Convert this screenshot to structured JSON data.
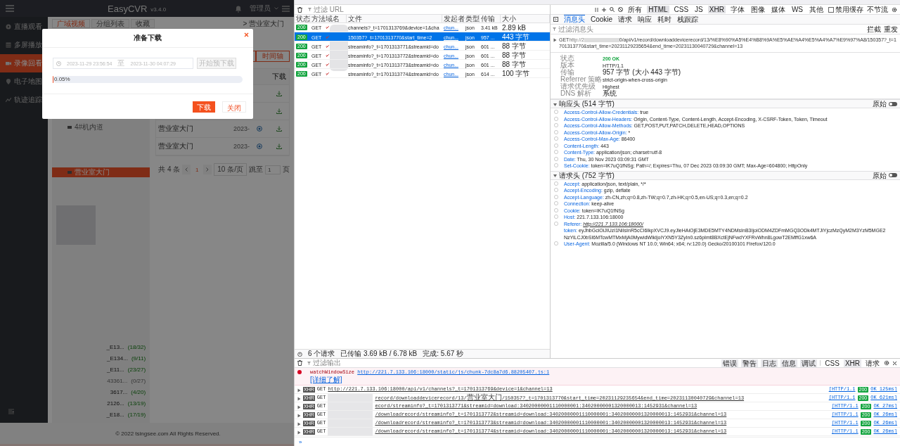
{
  "app": {
    "brand": "EasyCVR",
    "version": "v3.4.0",
    "user": "管理员",
    "nav": [
      {
        "label": "直播观看",
        "selected": false
      },
      {
        "label": "多屏播放",
        "selected": false
      },
      {
        "label": "录像回看",
        "selected": true
      },
      {
        "label": "电子地图",
        "selected": false
      },
      {
        "label": "轨迹追踪",
        "selected": false
      }
    ],
    "tabs": [
      {
        "label": "广域视频",
        "selected": true
      },
      {
        "label": "分组列表",
        "selected": false
      },
      {
        "label": "收藏",
        "selected": false
      }
    ],
    "breadcrumb": "> 营业室大门",
    "tree": {
      "items": [
        {
          "label": "4#机内道",
          "selected": false
        },
        {
          "label": "营业室大门",
          "selected": true
        }
      ],
      "devices": [
        {
          "label": "_E13...",
          "count": "(18/32)",
          "online": true
        },
        {
          "label": "_E134...",
          "count": "(9/11)",
          "online": true
        },
        {
          "label": "_E11...",
          "count": "(23/27)",
          "online": true
        },
        {
          "label": "43361...",
          "count": "(0/27)",
          "online": false
        },
        {
          "label": "3617...",
          "count": "(4/20)",
          "online": true
        },
        {
          "label": "2126...",
          "count": "(13/19)",
          "online": true
        },
        {
          "label": "_E18...",
          "count": "(17/19)",
          "online": true
        }
      ]
    },
    "timeline_button": "时间轴",
    "table": {
      "column": "下载",
      "rows": [
        {},
        {},
        {
          "name": "营业室大门",
          "date": "2023-"
        },
        {
          "name": "营业室大门",
          "date": "2023-"
        }
      ]
    },
    "pagination": {
      "total": "共 4 条",
      "page": "1",
      "page_size": "10 条/页",
      "jump_label": "跳至",
      "jump_value": "1",
      "suffix": "页"
    },
    "footer": "© 2022 tsingsee.com All Rights Reserved.",
    "dialog": {
      "title": "准备下载",
      "start": "2023-11-29 23:56:54",
      "separator": "至",
      "end": "2023-11-30 04:07:29",
      "predownload_button": "开始预下载",
      "predownload_disabled": true,
      "level": 0.0005,
      "progress_text": "0.05%",
      "download_button": "下载",
      "close_button": "关闭"
    }
  },
  "devtools": {
    "url_filter_placeholder": "过滤 URL",
    "type_filters": [
      {
        "label": "所有",
        "selected": false
      },
      {
        "label": "HTML",
        "selected": true
      },
      {
        "label": "CSS",
        "selected": false
      },
      {
        "label": "JS",
        "selected": false
      },
      {
        "label": "XHR",
        "selected": true
      },
      {
        "label": "字体",
        "selected": false
      },
      {
        "label": "图像",
        "selected": false
      },
      {
        "label": "媒体",
        "selected": false
      },
      {
        "label": "WS",
        "selected": false
      },
      {
        "label": "其他",
        "selected": false
      }
    ],
    "disable_cache": {
      "label": "禁用缓存",
      "checked": false
    },
    "throttle": "不节流",
    "network": {
      "columns": [
        "状态",
        "方法",
        "域名",
        "文件",
        "发起者",
        "类型",
        "传输",
        "大小"
      ],
      "rows": [
        {
          "status": "200",
          "method": "GET",
          "file": "channels?_t=1701313769&device=1&cha",
          "initiator": "chun...",
          "type": "json",
          "transferred": "3.41 kB",
          "size": "2.89 kB",
          "selected": false
        },
        {
          "status": "200",
          "method": "GET",
          "file": "150357?_t=1701313770&start_time=2",
          "initiator": "chun...",
          "type": "json",
          "transferred": "957 ...",
          "size": "443 字节",
          "selected": true
        },
        {
          "status": "200",
          "method": "GET",
          "file": "streaminfo?_t=1701313771&streamid=do",
          "initiator": "chun...",
          "type": "json",
          "transferred": "601 ...",
          "size": "88 字节",
          "selected": false
        },
        {
          "status": "200",
          "method": "GET",
          "file": "streaminfo?_t=1701313772&streamid=do",
          "initiator": "chun...",
          "type": "json",
          "transferred": "601 ...",
          "size": "88 字节",
          "selected": false
        },
        {
          "status": "200",
          "method": "GET",
          "file": "streaminfo?_t=1701313773&streamid=do",
          "initiator": "chun...",
          "type": "json",
          "transferred": "601 ...",
          "size": "88 字节",
          "selected": false
        },
        {
          "status": "200",
          "method": "GET",
          "file": "streaminfo?_t=1701313774&streamid=do",
          "initiator": "chun...",
          "type": "json",
          "transferred": "614 ...",
          "size": "100 字节",
          "selected": false
        }
      ],
      "summary": [
        "6 个请求",
        "已传输 3.69 kB / 6.78 kB",
        "完成: 5.67 秒"
      ]
    },
    "detail_tabs": [
      {
        "label": "消息头",
        "selected": true
      },
      {
        "label": "Cookie",
        "selected": false
      },
      {
        "label": "请求",
        "selected": false
      },
      {
        "label": "响应",
        "selected": false
      },
      {
        "label": "耗时",
        "selected": false
      },
      {
        "label": "栈跟踪",
        "selected": false
      }
    ],
    "header_filter_placeholder": "过滤消息头",
    "header_actions": [
      "拦截",
      "重发"
    ],
    "request_line": {
      "method": "GET",
      "url_start": "http://2",
      "url_rest": "0/api/v1/record/downloaddevicerecord/13/%E8%90%A5%E4%B8%9A%E5%AE%A4%E5%A4%A7%E9%97%A8/150357?_t=1701313770&start_time=20231129235654&end_time=20231130040729&channel=13"
    },
    "summary_rows": [
      {
        "label": "状态",
        "value": "200 OK",
        "kind": "status"
      },
      {
        "label": "版本",
        "value": "HTTP/1.1",
        "kind": "text"
      },
      {
        "label": "传输",
        "value": "957 字节 (大小 443 字节)",
        "kind": "text"
      },
      {
        "label": "Referrer 策略",
        "value": "strict-origin-when-cross-origin",
        "kind": "text"
      },
      {
        "label": "请求优先级",
        "value": "Highest",
        "kind": "text"
      },
      {
        "label": "DNS 解析",
        "value": "系统",
        "kind": "text"
      }
    ],
    "sections": [
      {
        "title": "响应头 (514 字节)",
        "raw_label": "原始",
        "raw": false,
        "expanded": true,
        "items": [
          {
            "name": "Access-Control-Allow-Credentials:",
            "value": "true",
            "kind": "text"
          },
          {
            "name": "Access-Control-Allow-Headers:",
            "value": "Origin, Content-Type, Content-Length, Accept-Encoding, X-CSRF-Token, Token, Timeout",
            "kind": "text"
          },
          {
            "name": "Access-Control-Allow-Methods:",
            "value": "GET,POST,PUT,PATCH,DELETE,HEAD,OPTIONS",
            "kind": "text"
          },
          {
            "name": "Access-Control-Allow-Origin:",
            "value": "*",
            "kind": "text"
          },
          {
            "name": "Access-Control-Max-Age:",
            "value": "86400",
            "kind": "text"
          },
          {
            "name": "Content-Length:",
            "value": "443",
            "kind": "text"
          },
          {
            "name": "Content-Type:",
            "value": "application/json; charset=utf-8",
            "kind": "text"
          },
          {
            "name": "Date:",
            "value": "Thu, 30 Nov 2023 03:09:31 GMT",
            "kind": "text"
          },
          {
            "name": "Set-Cookie:",
            "value": "token=lK7uQ1fNSg; Path=/; Expires=Thu, 07 Dec 2023 03:09:30 GMT; Max-Age=604800; HttpOnly",
            "kind": "text"
          }
        ]
      },
      {
        "title": "请求头 (752 字节)",
        "raw_label": "原始",
        "raw": false,
        "expanded": true,
        "items": [
          {
            "name": "Accept:",
            "value": "application/json, text/plain, */*",
            "kind": "text"
          },
          {
            "name": "Accept-Encoding:",
            "value": "gzip, deflate",
            "kind": "text"
          },
          {
            "name": "Accept-Language:",
            "value": "zh-CN,zh;q=0.8,zh-TW;q=0.7,zh-HK;q=0.5,en-US;q=0.3,en;q=0.2",
            "kind": "text"
          },
          {
            "name": "Connection:",
            "value": "keep-alive",
            "kind": "text"
          },
          {
            "name": "Cookie:",
            "value": "token=lK7uQ1fNSg",
            "kind": "text"
          },
          {
            "name": "Host:",
            "value": "221.7.133.106:18000",
            "kind": "text"
          },
          {
            "name": "Referer:",
            "value": "http://221.7.133.106:18000/",
            "kind": "link"
          },
          {
            "name": "token:",
            "value": "eyJhbGciOiJIUzI1NiIsInR5cCI6IkpXVCJ9.eyJleHAiOjE3MDE5MTY4NDMsInB3IjoiODM4ZDFmMGQ3ODk4MTJiYjczMzQyM2M3YzM5MGE2NzYiLCJ0bSI6MTcwMTMxMjA0MywidWlkIjoiYXN5Y3ZyIn0.sz6pImt8BXctEjNFwdYXFRvWhn8LgowT2EMffG1xw6A",
            "kind": "plain"
          },
          {
            "name": "User-Agent:",
            "value": "Mozilla/5.0 (Windows NT 10.0; Win64; x64; rv:120.0) Gecko/20100101 Firefox/120.0",
            "kind": "text"
          }
        ]
      }
    ],
    "console": {
      "filter_placeholder": "过滤输出",
      "levels": [
        {
          "label": "错误",
          "selected": true
        },
        {
          "label": "警告",
          "selected": true
        },
        {
          "label": "日志",
          "selected": true
        },
        {
          "label": "信息",
          "selected": true
        },
        {
          "label": "调试",
          "selected": true
        }
      ],
      "types": [
        {
          "label": "CSS",
          "selected": false
        },
        {
          "label": "XHR",
          "selected": true
        },
        {
          "label": "请求",
          "selected": false
        }
      ],
      "error": {
        "function": "watchWindowSize",
        "link": "http://221.7.133.106:18000/static/js/chunk-7dc8a7d6.88205407.js:1",
        "learn_more": "[详细了解]"
      },
      "requests": [
        {
          "tag": "XHR",
          "method": "GET",
          "url": "http://221.7.133.106:18000/api/v1/channels?_t=1701313769&device=1&channel=13",
          "redacted": false,
          "protocol": "[HTTP/1.1",
          "status": "200",
          "result": "OK 125ms]"
        },
        {
          "tag": "XHR",
          "method": "GET",
          "url": "record/downloaddevicerecord/13/营业室大门/150357?_t=1701313770&start_time=20231129235654&end_time=20231130040729&channel=13",
          "redacted": true,
          "protocol": "[HTTP/1.1",
          "status": "200",
          "result": "OK 621ms]"
        },
        {
          "tag": "XHR",
          "method": "GET",
          "url": "ecord/streaminfo?_t=1701313771&streamid=download:34020000001110000001:34020000001320000013:1452931&channel=13",
          "redacted": true,
          "protocol": "[HTTP/1.1",
          "status": "200",
          "result": "OK 27ms]"
        },
        {
          "tag": "XHR",
          "method": "GET",
          "url": "/downloadrecord/streaminfo?_t=1701313772&streamid=download:34020000001110000001:34020000001320000013:1452931&channel=13",
          "redacted": true,
          "protocol": "[HTTP/1.1",
          "status": "200",
          "result": "OK 26ms]"
        },
        {
          "tag": "XHR",
          "method": "GET",
          "url": "/downloadrecord/streaminfo?_t=1701313773&streamid=download:34020000001110000001:34020000001320000013:1452931&channel=13",
          "redacted": true,
          "protocol": "[HTTP/1.1",
          "status": "200",
          "result": "OK 26ms]"
        },
        {
          "tag": "XHR",
          "method": "GET",
          "url": "/downloadrecord/streaminfo?_t=1701313774&streamid=download:34020000001110000001:34020000001320000013:1452931&channel=13",
          "redacted": true,
          "protocol": "[HTTP/1.1",
          "status": "200",
          "result": "OK 26ms]"
        }
      ],
      "prompt": "»"
    }
  }
}
